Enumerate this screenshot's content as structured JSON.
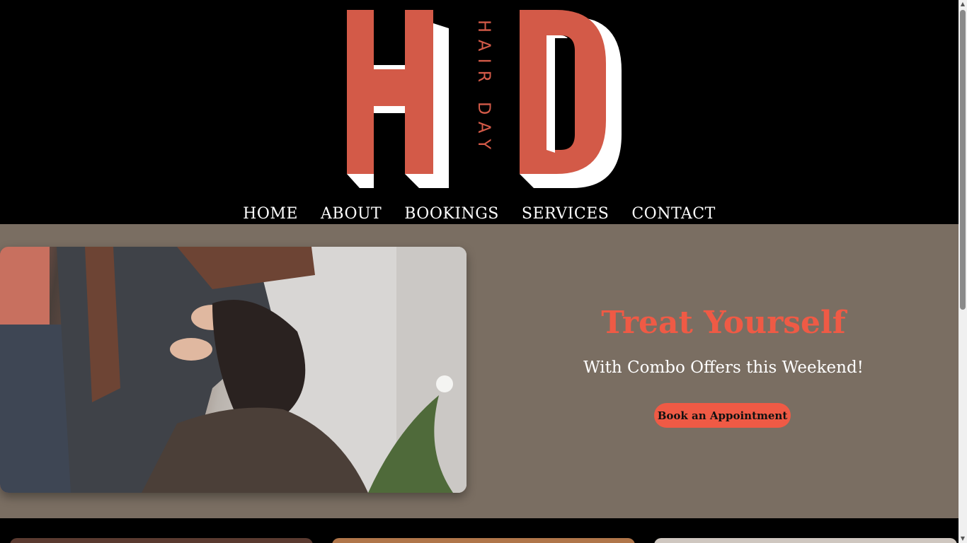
{
  "brand": {
    "logo_letters": "HD",
    "tagline": "HAIR DAY",
    "colors": {
      "accent": "#d35a48",
      "background": "#000000"
    }
  },
  "nav": {
    "items": [
      {
        "label": "HOME"
      },
      {
        "label": "ABOUT"
      },
      {
        "label": "BOOKINGS"
      },
      {
        "label": "SERVICES"
      },
      {
        "label": "CONTACT"
      }
    ]
  },
  "hero": {
    "title": "Treat Yourself",
    "subtitle": "With Combo Offers this Weekend!",
    "cta_label": "Book an Appointment",
    "photo": "hairdresser-cutting-hair-photo",
    "colors": {
      "background": "#7a6e62",
      "title": "#ef5a45",
      "button": "#ef5a45"
    }
  },
  "cards": {
    "count_visible": 3
  }
}
